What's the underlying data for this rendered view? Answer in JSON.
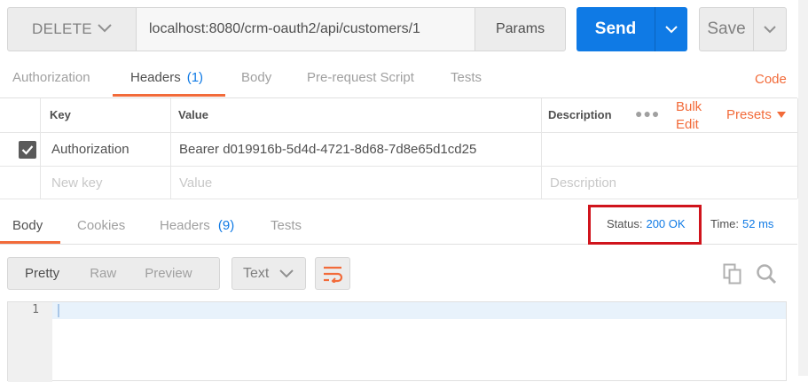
{
  "request": {
    "method": "DELETE",
    "url": "localhost:8080/crm-oauth2/api/customers/1",
    "params_label": "Params",
    "send_label": "Send",
    "save_label": "Save"
  },
  "request_tabs": {
    "authorization": "Authorization",
    "headers": "Headers",
    "headers_count": "(1)",
    "body": "Body",
    "pre_request": "Pre-request Script",
    "tests": "Tests",
    "code": "Code"
  },
  "headers_table": {
    "col_key": "Key",
    "col_value": "Value",
    "col_description": "Description",
    "bulk_edit": "Bulk Edit",
    "presets": "Presets",
    "row": {
      "key": "Authorization",
      "value": "Bearer d019916b-5d4d-4721-8d68-7d8e65d1cd25",
      "checked": true
    },
    "new_key_placeholder": "New key",
    "value_placeholder": "Value",
    "description_placeholder": "Description"
  },
  "response_tabs": {
    "body": "Body",
    "cookies": "Cookies",
    "headers": "Headers",
    "headers_count": "(9)",
    "tests": "Tests"
  },
  "response_status": {
    "status_label": "Status:",
    "status_value": "200 OK",
    "time_label": "Time:",
    "time_value": "52 ms"
  },
  "view_modes": {
    "pretty": "Pretty",
    "raw": "Raw",
    "preview": "Preview",
    "format": "Text"
  },
  "editor": {
    "line_number": "1"
  },
  "colors": {
    "accent": "#f26b3a",
    "primary": "#0f7ae5",
    "highlight": "#d0141c"
  }
}
